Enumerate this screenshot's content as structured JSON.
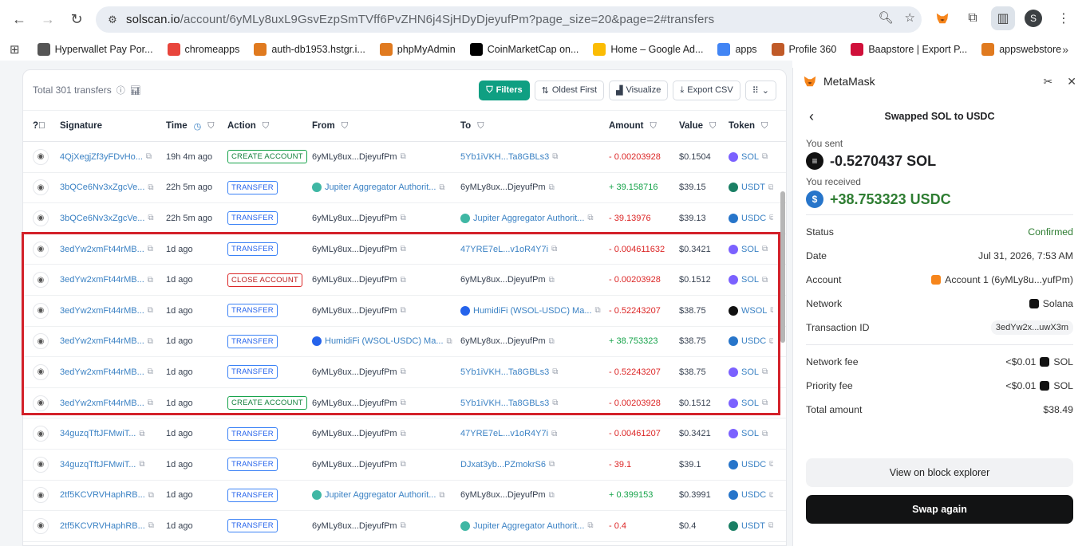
{
  "browser": {
    "url_host": "solscan.io",
    "url_path": "/account/6yMLy8uxL9GsvEzpSmTVff6PvZHN6j4SjHDyDjeyufPm?page_size=20&page=2#transfers",
    "profile_initial": "S",
    "bookmarks": [
      {
        "label": "Hyperwallet Pay Por...",
        "color": "#555555"
      },
      {
        "label": "chromeapps",
        "color": "#e8453c"
      },
      {
        "label": "auth-db1953.hstgr.i...",
        "color": "#e07a1f"
      },
      {
        "label": "phpMyAdmin",
        "color": "#e07a1f"
      },
      {
        "label": "CoinMarketCap on...",
        "color": "#000000"
      },
      {
        "label": "Home – Google Ad...",
        "color": "#fbbc04"
      },
      {
        "label": "apps",
        "color": "#4285f4"
      },
      {
        "label": "Profile 360",
        "color": "#c05a28"
      },
      {
        "label": "Baapstore | Export P...",
        "color": "#d0103a"
      },
      {
        "label": "appswebstore",
        "color": "#e07a1f"
      }
    ]
  },
  "transfers": {
    "total_label": "Total 301 transfers",
    "buttons": {
      "filters": "Filters",
      "oldest": "Oldest First",
      "visualize": "Visualize",
      "export": "Export CSV"
    },
    "columns": [
      "Signature",
      "Time",
      "Action",
      "From",
      "To",
      "Amount",
      "Value",
      "Token"
    ],
    "rows": [
      {
        "sig": "4QjXegjZf3yFDvHo...",
        "time": "19h 4m ago",
        "action": "CREATE ACCOUNT",
        "action_style": "green",
        "from": "6yMLy8ux...DjeyufPm",
        "from_link": false,
        "from_icon": "",
        "to": "5Yb1iVKH...Ta8GBLs3",
        "to_link": true,
        "to_icon": "",
        "amount": "- 0.00203928",
        "amount_sign": "neg",
        "value": "$0.1504",
        "token": "SOL",
        "token_color": "#7b61ff"
      },
      {
        "sig": "3bQCe6Nv3xZgcVe...",
        "time": "22h 5m ago",
        "action": "TRANSFER",
        "action_style": "blue",
        "from": "Jupiter Aggregator Authorit...",
        "from_link": true,
        "from_icon": "#3fb7a4",
        "to": "6yMLy8ux...DjeyufPm",
        "to_link": false,
        "to_icon": "",
        "amount": "+ 39.158716",
        "amount_sign": "pos",
        "value": "$39.15",
        "token": "USDT",
        "token_color": "#1a7f64"
      },
      {
        "sig": "3bQCe6Nv3xZgcVe...",
        "time": "22h 5m ago",
        "action": "TRANSFER",
        "action_style": "blue",
        "from": "6yMLy8ux...DjeyufPm",
        "from_link": false,
        "from_icon": "",
        "to": "Jupiter Aggregator Authorit...",
        "to_link": true,
        "to_icon": "#3fb7a4",
        "amount": "- 39.13976",
        "amount_sign": "neg",
        "value": "$39.13",
        "token": "USDC",
        "token_color": "#2775ca"
      },
      {
        "sig": "3edYw2xmFt44rMB...",
        "time": "1d ago",
        "action": "TRANSFER",
        "action_style": "blue",
        "from": "6yMLy8ux...DjeyufPm",
        "from_link": false,
        "from_icon": "",
        "to": "47YRE7eL...v1oR4Y7i",
        "to_link": true,
        "to_icon": "",
        "amount": "- 0.004611632",
        "amount_sign": "neg",
        "value": "$0.3421",
        "token": "SOL",
        "token_color": "#7b61ff"
      },
      {
        "sig": "3edYw2xmFt44rMB...",
        "time": "1d ago",
        "action": "CLOSE ACCOUNT",
        "action_style": "red",
        "from": "6yMLy8ux...DjeyufPm",
        "from_link": false,
        "from_icon": "",
        "to": "6yMLy8ux...DjeyufPm",
        "to_link": false,
        "to_icon": "",
        "amount": "- 0.00203928",
        "amount_sign": "neg",
        "value": "$0.1512",
        "token": "SOL",
        "token_color": "#7b61ff"
      },
      {
        "sig": "3edYw2xmFt44rMB...",
        "time": "1d ago",
        "action": "TRANSFER",
        "action_style": "blue",
        "from": "6yMLy8ux...DjeyufPm",
        "from_link": false,
        "from_icon": "",
        "to": "HumidiFi (WSOL-USDC) Ma...",
        "to_link": true,
        "to_icon": "#2563eb",
        "amount": "- 0.52243207",
        "amount_sign": "neg",
        "value": "$38.75",
        "token": "WSOL",
        "token_color": "#111111"
      },
      {
        "sig": "3edYw2xmFt44rMB...",
        "time": "1d ago",
        "action": "TRANSFER",
        "action_style": "blue",
        "from": "HumidiFi (WSOL-USDC) Ma...",
        "from_link": true,
        "from_icon": "#2563eb",
        "to": "6yMLy8ux...DjeyufPm",
        "to_link": false,
        "to_icon": "",
        "amount": "+ 38.753323",
        "amount_sign": "pos",
        "value": "$38.75",
        "token": "USDC",
        "token_color": "#2775ca"
      },
      {
        "sig": "3edYw2xmFt44rMB...",
        "time": "1d ago",
        "action": "TRANSFER",
        "action_style": "blue",
        "from": "6yMLy8ux...DjeyufPm",
        "from_link": false,
        "from_icon": "",
        "to": "5Yb1iVKH...Ta8GBLs3",
        "to_link": true,
        "to_icon": "",
        "amount": "- 0.52243207",
        "amount_sign": "neg",
        "value": "$38.75",
        "token": "SOL",
        "token_color": "#7b61ff"
      },
      {
        "sig": "3edYw2xmFt44rMB...",
        "time": "1d ago",
        "action": "CREATE ACCOUNT",
        "action_style": "green",
        "from": "6yMLy8ux...DjeyufPm",
        "from_link": false,
        "from_icon": "",
        "to": "5Yb1iVKH...Ta8GBLs3",
        "to_link": true,
        "to_icon": "",
        "amount": "- 0.00203928",
        "amount_sign": "neg",
        "value": "$0.1512",
        "token": "SOL",
        "token_color": "#7b61ff"
      },
      {
        "sig": "34guzqTftJFMwiT...",
        "time": "1d ago",
        "action": "TRANSFER",
        "action_style": "blue",
        "from": "6yMLy8ux...DjeyufPm",
        "from_link": false,
        "from_icon": "",
        "to": "47YRE7eL...v1oR4Y7i",
        "to_link": true,
        "to_icon": "",
        "amount": "- 0.00461207",
        "amount_sign": "neg",
        "value": "$0.3421",
        "token": "SOL",
        "token_color": "#7b61ff"
      },
      {
        "sig": "34guzqTftJFMwiT...",
        "time": "1d ago",
        "action": "TRANSFER",
        "action_style": "blue",
        "from": "6yMLy8ux...DjeyufPm",
        "from_link": false,
        "from_icon": "",
        "to": "DJxat3yb...PZmokrS6",
        "to_link": true,
        "to_icon": "",
        "amount": "- 39.1",
        "amount_sign": "neg",
        "value": "$39.1",
        "token": "USDC",
        "token_color": "#2775ca"
      },
      {
        "sig": "2tf5KCVRVHaphRB...",
        "time": "1d ago",
        "action": "TRANSFER",
        "action_style": "blue",
        "from": "Jupiter Aggregator Authorit...",
        "from_link": true,
        "from_icon": "#3fb7a4",
        "to": "6yMLy8ux...DjeyufPm",
        "to_link": false,
        "to_icon": "",
        "amount": "+ 0.399153",
        "amount_sign": "pos",
        "value": "$0.3991",
        "token": "USDC",
        "token_color": "#2775ca"
      },
      {
        "sig": "2tf5KCVRVHaphRB...",
        "time": "1d ago",
        "action": "TRANSFER",
        "action_style": "blue",
        "from": "6yMLy8ux...DjeyufPm",
        "from_link": false,
        "from_icon": "",
        "to": "Jupiter Aggregator Authorit...",
        "to_link": true,
        "to_icon": "#3fb7a4",
        "amount": "- 0.4",
        "amount_sign": "neg",
        "value": "$0.4",
        "token": "USDT",
        "token_color": "#1a7f64"
      }
    ]
  },
  "metamask": {
    "app_name": "MetaMask",
    "title": "Swapped SOL to USDC",
    "sent_label": "You sent",
    "sent_amount": "-0.5270437 SOL",
    "received_label": "You received",
    "received_amount": "+38.753323 USDC",
    "details": [
      {
        "key": "Status",
        "value": "Confirmed",
        "style": "green"
      },
      {
        "key": "Date",
        "value": "Jul 31, 2026, 7:53 AM",
        "style": ""
      },
      {
        "key": "Account",
        "value": "Account 1 (6yMLy8u...yufPm)",
        "style": "account"
      },
      {
        "key": "Network",
        "value": "Solana",
        "style": "network"
      },
      {
        "key": "Transaction ID",
        "value": "3edYw2x...uwX3m",
        "style": "pill"
      }
    ],
    "fees": [
      {
        "key": "Network fee",
        "value": "<$0.01",
        "unit": "SOL"
      },
      {
        "key": "Priority fee",
        "value": "<$0.01",
        "unit": "SOL"
      },
      {
        "key": "Total amount",
        "value": "$38.49",
        "unit": ""
      }
    ],
    "explorer_button": "View on block explorer",
    "swap_button": "Swap again"
  }
}
